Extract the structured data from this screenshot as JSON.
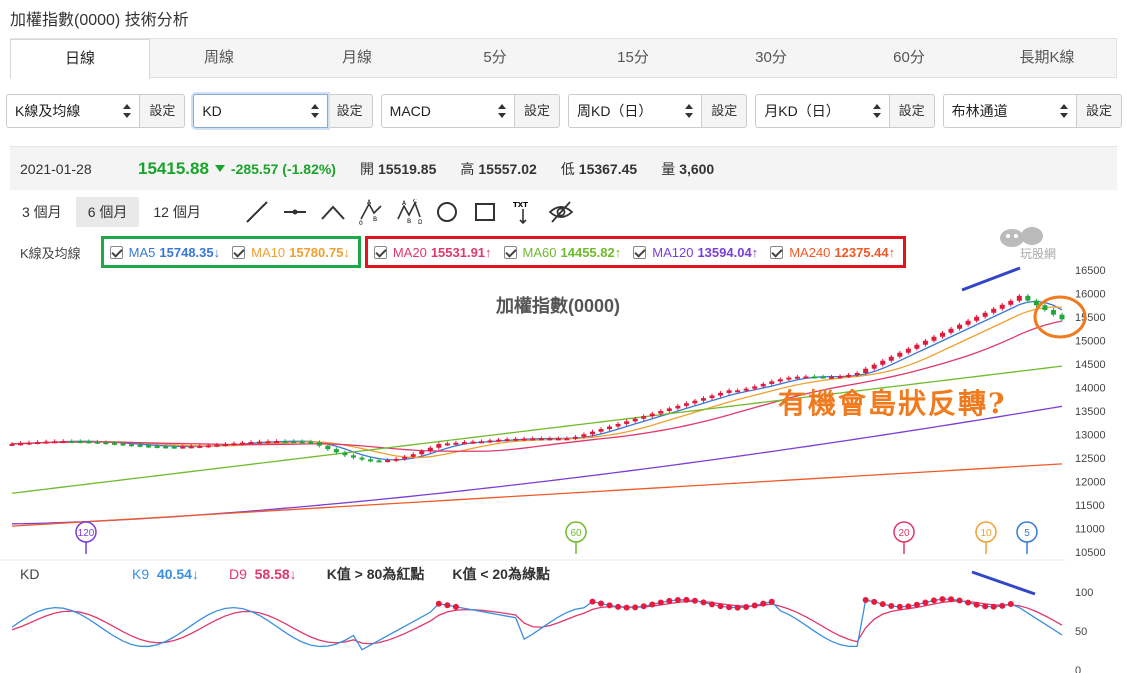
{
  "page": {
    "title": "加權指數(0000) 技術分析"
  },
  "tabs": [
    {
      "label": "日線",
      "active": true
    },
    {
      "label": "周線"
    },
    {
      "label": "月線"
    },
    {
      "label": "5分"
    },
    {
      "label": "15分"
    },
    {
      "label": "30分"
    },
    {
      "label": "60分"
    },
    {
      "label": "長期K線"
    }
  ],
  "selectors": [
    {
      "value": "K線及均線",
      "button": "設定"
    },
    {
      "value": "KD",
      "button": "設定",
      "focused": true
    },
    {
      "value": "MACD",
      "button": "設定"
    },
    {
      "value": "周KD（日）",
      "button": "設定"
    },
    {
      "value": "月KD（日）",
      "button": "設定"
    },
    {
      "value": "布林通道",
      "button": "設定"
    }
  ],
  "quote": {
    "date": "2021-01-28",
    "price": "15415.88",
    "change": "-285.57 (-1.82%)",
    "open_label": "開",
    "open": "15519.85",
    "high_label": "高",
    "high": "15557.02",
    "low_label": "低",
    "low": "15367.45",
    "volume_label": "量",
    "volume": "3,600"
  },
  "ranges": [
    {
      "label": "3 個月"
    },
    {
      "label": "6 個月",
      "active": true
    },
    {
      "label": "12 個月"
    }
  ],
  "tools": [
    "line-tool-icon",
    "horizontal-line-icon",
    "angle-tool-icon",
    "abc-pattern-icon",
    "abcd-pattern-icon",
    "circle-tool-icon",
    "rectangle-tool-icon",
    "text-tool-icon",
    "hide-icon"
  ],
  "ma_legend": {
    "title": "K線及均線",
    "items": [
      {
        "name": "MA5",
        "value": "15748.35↓",
        "color": "#3a78d6",
        "group": "green"
      },
      {
        "name": "MA10",
        "value": "15780.75↓",
        "color": "#f0a030",
        "group": "green"
      },
      {
        "name": "MA20",
        "value": "15531.91↑",
        "color": "#e0386a",
        "group": "red"
      },
      {
        "name": "MA60",
        "value": "14455.82↑",
        "color": "#6fba2c",
        "group": "red"
      },
      {
        "name": "MA120",
        "value": "13594.04↑",
        "color": "#7a3fd6",
        "group": "red"
      },
      {
        "name": "MA240",
        "value": "12375.44↑",
        "color": "#f05a28",
        "group": "red"
      }
    ]
  },
  "chart_data": {
    "type": "candlestick",
    "title": "加權指數(0000)",
    "ylim": [
      10500,
      16500
    ],
    "y_ticks": [
      "16500",
      "16000",
      "15500",
      "15000",
      "14500",
      "14000",
      "13500",
      "13000",
      "12500",
      "12000",
      "11500",
      "11000",
      "10500"
    ],
    "period_markers": [
      "120",
      "60",
      "20",
      "10",
      "5"
    ],
    "annotation": "有機會島狀反轉?",
    "watermark": "玩股網"
  },
  "kd": {
    "title": "KD",
    "k_label": "K9",
    "k_value": "40.54↓",
    "d_label": "D9",
    "d_value": "58.58↓",
    "note_high": "K值 > 80為紅點",
    "note_low": "K值 < 20為綠點",
    "y_ticks": [
      "100",
      "50",
      "0"
    ],
    "k_color": "#3a8fe0",
    "d_color": "#e0386a"
  }
}
